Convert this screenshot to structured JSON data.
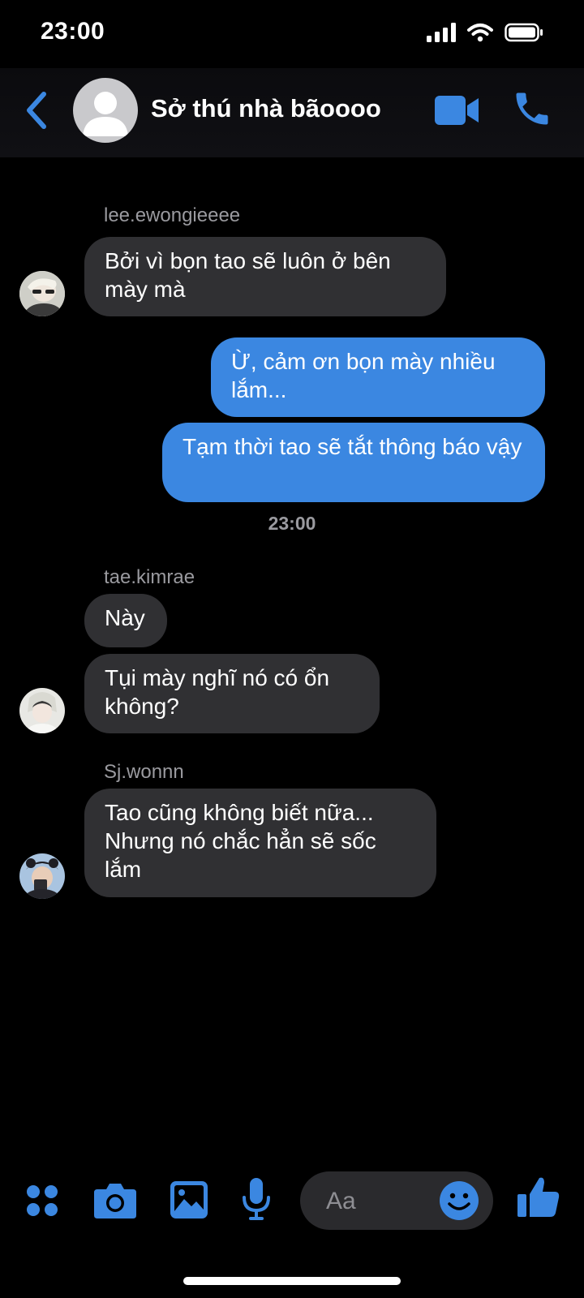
{
  "status": {
    "time": "23:00"
  },
  "header": {
    "title": "Sở thú nhà bãoooo"
  },
  "messages": [
    {
      "sender": "lee.ewongieeee",
      "text": "Bởi vì bọn tao sẽ luôn ở bên mày mà"
    },
    {
      "text": "Ừ, cảm ơn bọn mày nhiều lắm..."
    },
    {
      "text": "Tạm thời tao sẽ tắt thông báo vậy"
    },
    {
      "timestamp": "23:00"
    },
    {
      "sender": "tae.kimrae",
      "text": "Này"
    },
    {
      "text": "Tụi mày nghĩ nó có ổn không?"
    },
    {
      "sender": "Sj.wonnn",
      "text": "Tao cũng không biết nữa... Nhưng nó chắc hẳn sẽ sốc lắm"
    }
  ],
  "composer": {
    "placeholder": "Aa"
  },
  "colors": {
    "accent": "#3b87e1",
    "incoming_bubble": "#303033",
    "outgoing_bubble": "#3b87e1",
    "background": "#000000"
  }
}
